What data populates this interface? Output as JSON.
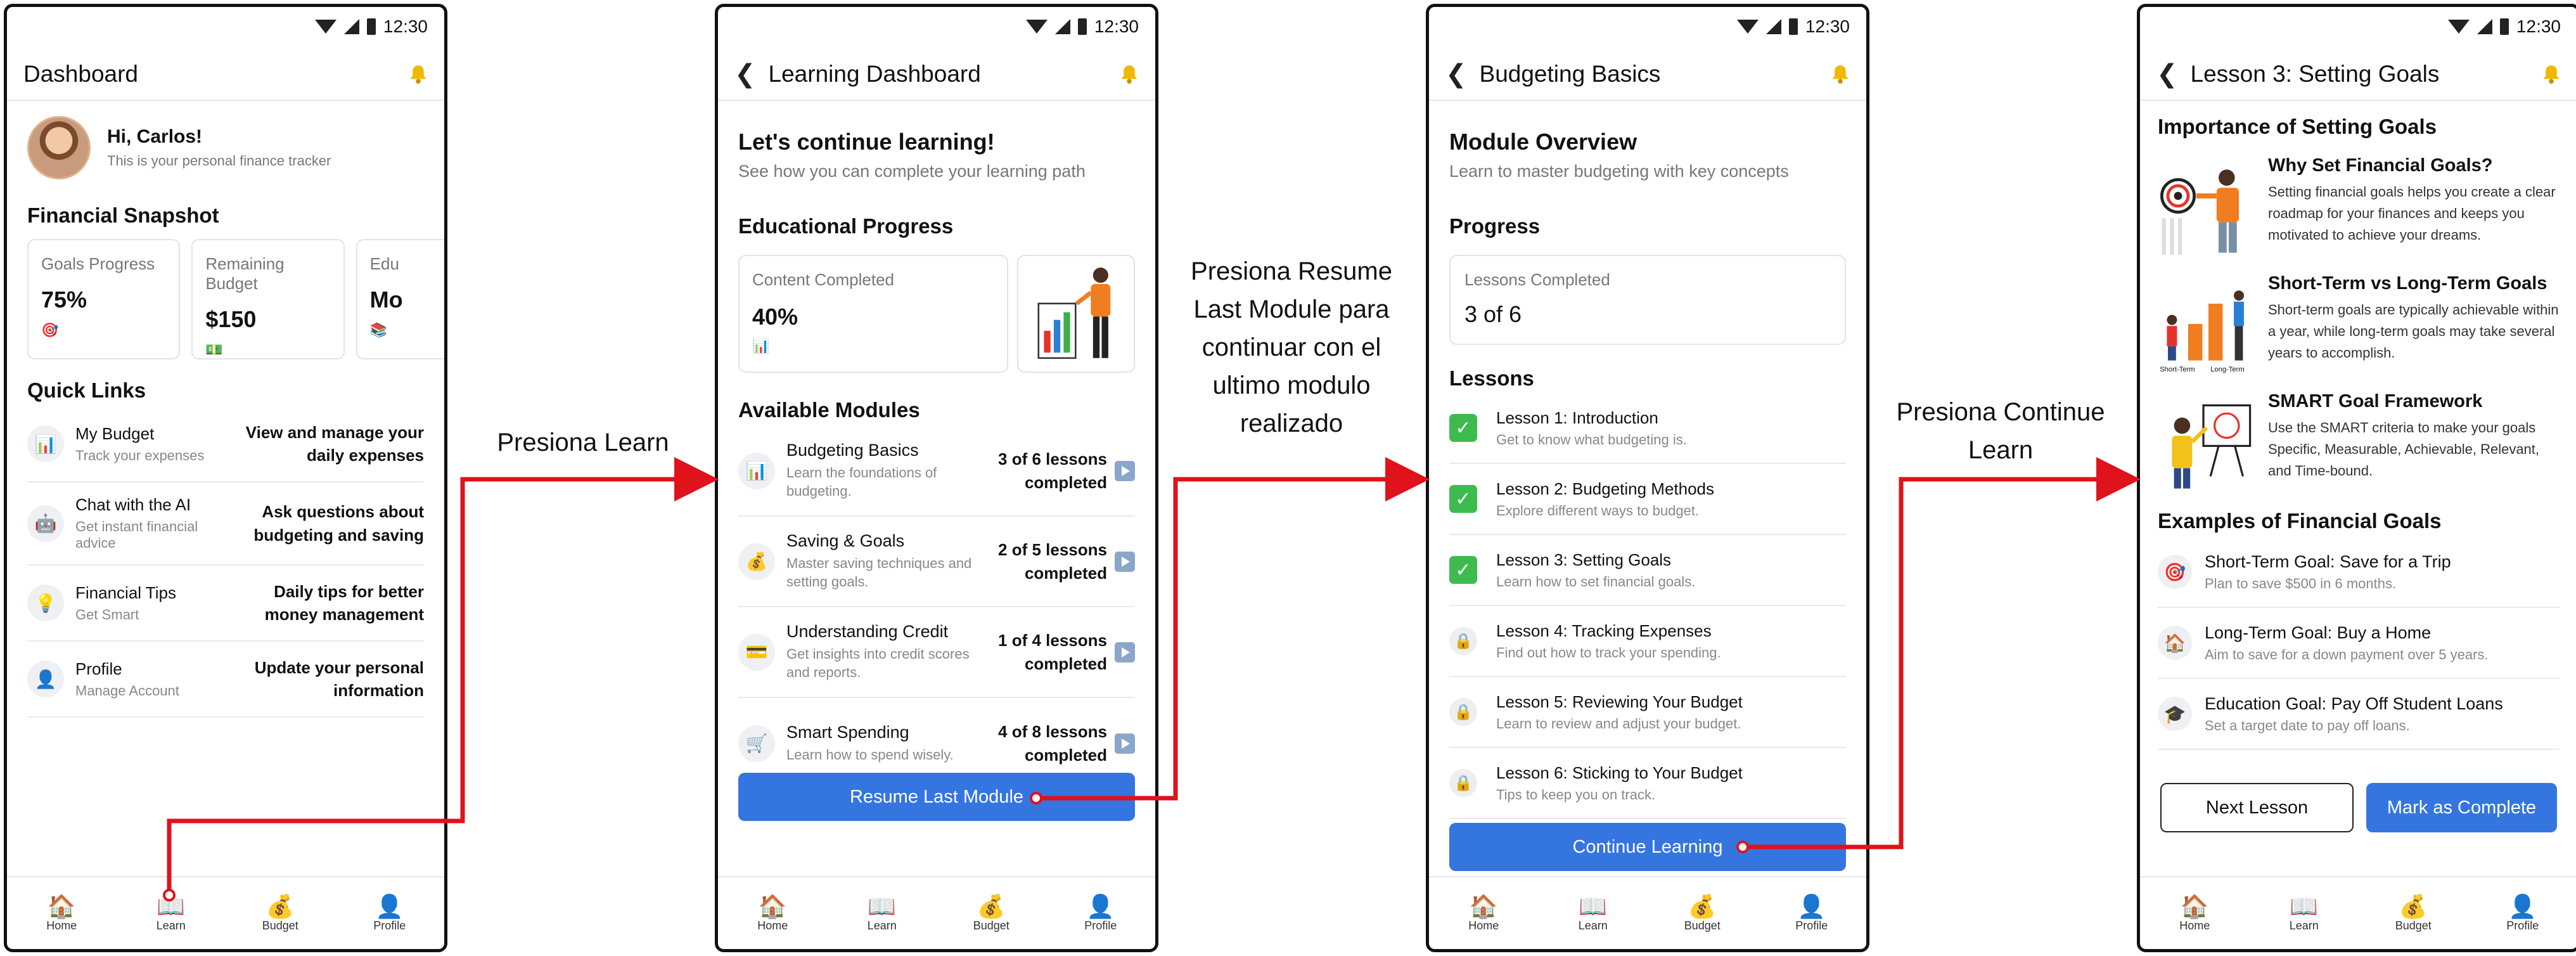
{
  "status": {
    "time": "12:30"
  },
  "nav": {
    "home": "Home",
    "learn": "Learn",
    "budget": "Budget",
    "profile": "Profile"
  },
  "screen1": {
    "title": "Dashboard",
    "greeting": "Hi, Carlos!",
    "greeting_sub": "This is your personal finance tracker",
    "snapshot_title": "Financial Snapshot",
    "cards": [
      {
        "label": "Goals Progress",
        "value": "75%"
      },
      {
        "label": "Remaining Budget",
        "value": "$150"
      },
      {
        "label": "Edu",
        "value": "Mo"
      }
    ],
    "quick_links_title": "Quick Links",
    "links": [
      {
        "title": "My Budget",
        "sub": "Track your expenses",
        "desc": "View and manage your daily expenses"
      },
      {
        "title": "Chat with the AI",
        "sub": "Get instant financial advice",
        "desc": "Ask questions about budgeting and saving"
      },
      {
        "title": "Financial Tips",
        "sub": "Get Smart",
        "desc": "Daily tips for better money management"
      },
      {
        "title": "Profile",
        "sub": "Manage Account",
        "desc": "Update your personal information"
      }
    ]
  },
  "screen2": {
    "title": "Learning Dashboard",
    "heading": "Let's continue learning!",
    "sub": "See how you can complete your learning path",
    "progress_title": "Educational Progress",
    "content_label": "Content Completed",
    "content_value": "40%",
    "modules_title": "Available Modules",
    "modules": [
      {
        "title": "Budgeting Basics",
        "sub": "Learn the foundations of budgeting.",
        "count": "3 of 6 lessons completed"
      },
      {
        "title": "Saving & Goals",
        "sub": "Master saving techniques and setting goals.",
        "count": "2 of 5 lessons completed"
      },
      {
        "title": "Understanding Credit",
        "sub": "Get insights into credit scores and reports.",
        "count": "1 of 4 lessons completed"
      },
      {
        "title": "Smart Spending",
        "sub": "Learn how to spend wisely.",
        "count": "4 of 8 lessons completed"
      }
    ],
    "button": "Resume Last Module"
  },
  "screen3": {
    "title": "Budgeting Basics",
    "heading": "Module Overview",
    "sub": "Learn to master budgeting with key concepts",
    "progress_title": "Progress",
    "lessons_label": "Lessons Completed",
    "lessons_value": "3 of 6",
    "lessons_title": "Lessons",
    "lessons": [
      {
        "title": "Lesson 1: Introduction",
        "sub": "Get to know what budgeting is.",
        "done": true
      },
      {
        "title": "Lesson 2: Budgeting Methods",
        "sub": "Explore different ways to budget.",
        "done": true
      },
      {
        "title": "Lesson 3: Setting Goals",
        "sub": "Learn how to set financial goals.",
        "done": true
      },
      {
        "title": "Lesson 4: Tracking Expenses",
        "sub": "Find out how to track your spending.",
        "done": false
      },
      {
        "title": "Lesson 5: Reviewing Your Budget",
        "sub": "Learn to review and adjust your budget.",
        "done": false
      },
      {
        "title": "Lesson 6: Sticking to Your Budget",
        "sub": "Tips to keep you on track.",
        "done": false
      }
    ],
    "button": "Continue Learning"
  },
  "screen4": {
    "title": "Lesson 3: Setting Goals",
    "importance_title": "Importance of Setting Goals",
    "items": [
      {
        "title": "Why Set Financial Goals?",
        "text": "Setting financial goals helps you create a clear roadmap for your finances and keeps you motivated to achieve your dreams."
      },
      {
        "title": "Short-Term vs Long-Term Goals",
        "text": "Short-term goals are typically achievable within a year, while long-term goals may take several years to accomplish."
      },
      {
        "title": "SMART Goal Framework",
        "text": "Use the SMART criteria to make your goals Specific, Measurable, Achievable, Relevant, and Time-bound."
      }
    ],
    "chart_labels": {
      "short": "Short-Term",
      "long": "Long-Term"
    },
    "examples_title": "Examples of Financial Goals",
    "examples": [
      {
        "title": "Short-Term Goal: Save for a Trip",
        "sub": "Plan to save $500 in 6 months."
      },
      {
        "title": "Long-Term Goal: Buy a Home",
        "sub": "Aim to save for a down payment over 5 years."
      },
      {
        "title": "Education Goal: Pay Off Student Loans",
        "sub": "Set a target date to pay off loans."
      }
    ],
    "next_button": "Next Lesson",
    "complete_button": "Mark as Complete"
  },
  "annotations": {
    "a1": "Presiona Learn",
    "a2_l1": "Presiona Resume",
    "a2_l2": "Last Module para",
    "a2_l3": "continuar con el",
    "a2_l4": "ultimo modulo",
    "a2_l5": "realizado",
    "a3_l1": "Presiona Continue",
    "a3_l2": "Learn"
  },
  "colors": {
    "primary": "#3575e0",
    "arrow": "#e0121b",
    "check": "#3dbb4f"
  }
}
